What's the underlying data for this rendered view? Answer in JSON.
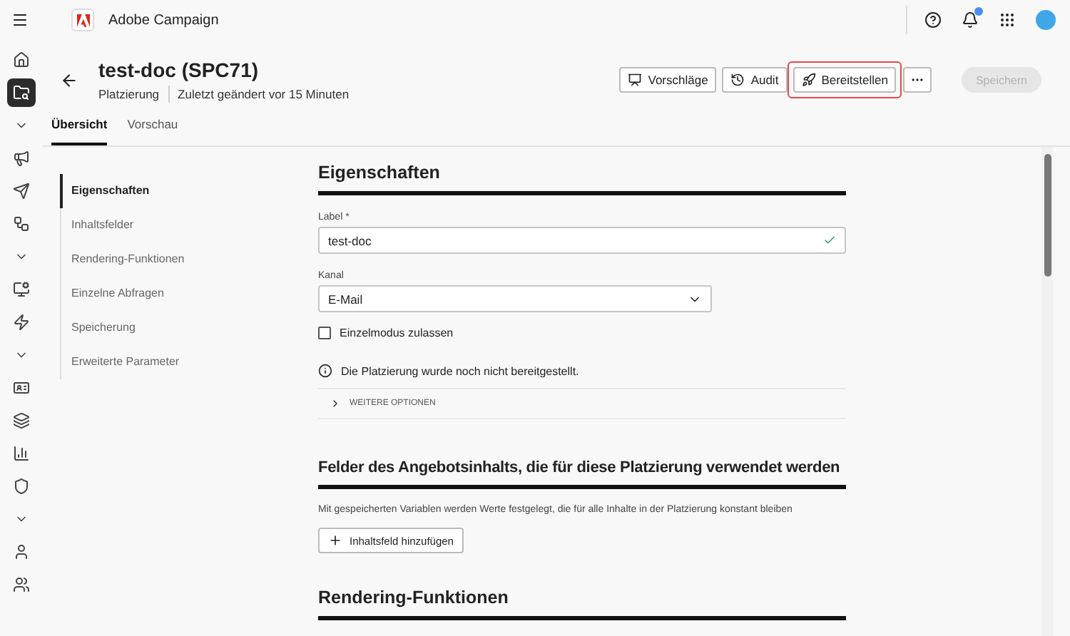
{
  "app": {
    "name": "Adobe Campaign",
    "notification": true
  },
  "rail": [
    {
      "kind": "home",
      "selected": false
    },
    {
      "kind": "browse",
      "selected": true
    },
    {
      "kind": "chevron",
      "selected": false
    },
    {
      "kind": "megaphone",
      "selected": false
    },
    {
      "kind": "send",
      "selected": false
    },
    {
      "kind": "flow",
      "selected": false
    },
    {
      "kind": "chevron",
      "selected": false
    },
    {
      "kind": "monitor",
      "selected": false
    },
    {
      "kind": "bolt",
      "selected": false
    },
    {
      "kind": "chevron",
      "selected": false
    },
    {
      "kind": "card",
      "selected": false
    },
    {
      "kind": "layers",
      "selected": false
    },
    {
      "kind": "chart",
      "selected": false
    },
    {
      "kind": "shield",
      "selected": false
    },
    {
      "kind": "chevron",
      "selected": false
    },
    {
      "kind": "person",
      "selected": false
    },
    {
      "kind": "people",
      "selected": false
    }
  ],
  "header": {
    "title": "test-doc (SPC71)",
    "type": "Platzierung",
    "modified": "Zuletzt geändert vor 15 Minuten"
  },
  "actions": [
    {
      "kind": "suggest",
      "label": "Vorschläge",
      "highlighted": false
    },
    {
      "kind": "audit",
      "label": "Audit",
      "highlighted": false
    },
    {
      "kind": "deploy",
      "label": "Bereitstellen",
      "highlighted": true
    }
  ],
  "save": {
    "label": "Speichern",
    "disabled": true
  },
  "tabs": [
    {
      "label": "Übersicht",
      "selected": true
    },
    {
      "label": "Vorschau",
      "selected": false
    }
  ],
  "nav": [
    {
      "label": "Eigenschaften",
      "selected": true
    },
    {
      "label": "Inhaltsfelder",
      "selected": false
    },
    {
      "label": "Rendering-Funktionen",
      "selected": false
    },
    {
      "label": "Einzelne Abfragen",
      "selected": false
    },
    {
      "label": "Speicherung",
      "selected": false
    },
    {
      "label": "Erweiterte Parameter",
      "selected": false
    }
  ],
  "properties": {
    "heading": "Eigenschaften",
    "label_field": {
      "label": "Label",
      "required_mark": "*",
      "value": "test-doc",
      "valid": true
    },
    "channel": {
      "label": "Kanal",
      "value": "E-Mail"
    },
    "single_mode": {
      "label": "Einzelmodus zulassen",
      "checked": false
    },
    "info": "Die Platzierung wurde noch nicht bereitgestellt.",
    "more_options": {
      "label": "WEITERE OPTIONEN",
      "expanded": false
    }
  },
  "fields": {
    "heading": "Felder des Angebotsinhalts, die für diese Platzierung verwendet werden",
    "description": "Mit gespeicherten Variablen werden Werte festgelegt, die für alle Inhalte in der Platzierung konstant bleiben",
    "button": "Inhaltsfeld hinzufügen"
  },
  "rendering": {
    "heading": "Rendering-Funktionen"
  }
}
